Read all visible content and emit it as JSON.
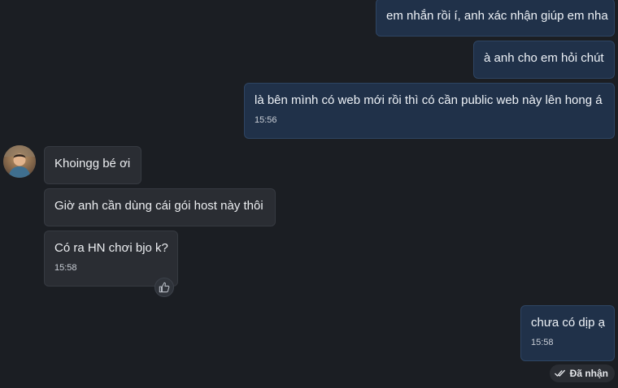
{
  "messages": [
    {
      "text": "em nhắn rồi í, anh xác nhận giúp em nha"
    },
    {
      "text": "à anh cho em hỏi chút"
    },
    {
      "text": "là bên mình có web mới rồi thì có cần public web này lên hong á",
      "time": "15:56"
    },
    {
      "text": "Khoingg bé ơi"
    },
    {
      "text": "Giờ anh cần dùng cái gói host này thôi"
    },
    {
      "text": "Có ra HN chơi bjo k?",
      "time": "15:58"
    },
    {
      "text": "chưa có dịp ạ",
      "time": "15:58"
    }
  ],
  "status": {
    "label": "Đã nhận"
  },
  "colors": {
    "background": "#1b1e23",
    "outgoing_bubble": "#203149",
    "incoming_bubble": "#2a2d33"
  },
  "icons": {
    "reaction": "thumbs-up-icon",
    "status": "double-check-icon"
  }
}
